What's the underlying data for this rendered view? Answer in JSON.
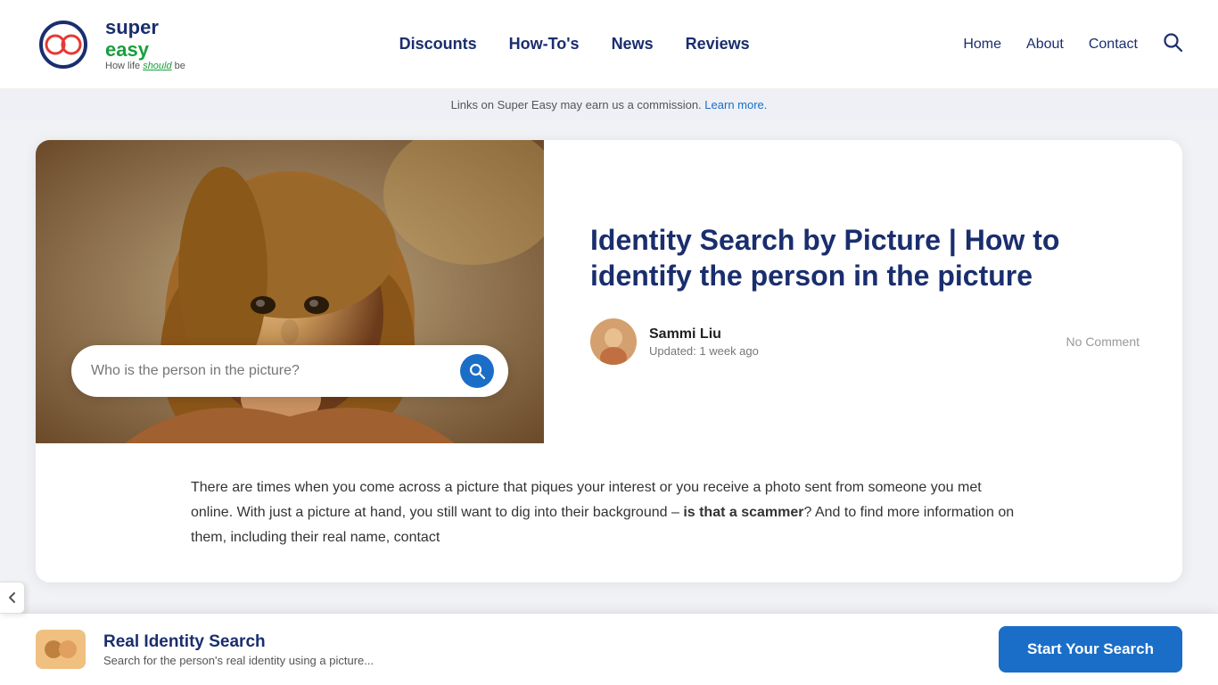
{
  "header": {
    "logo": {
      "brand_super": "super",
      "brand_easy": "easy",
      "tagline": "How life should be"
    },
    "main_nav": [
      {
        "label": "Discounts",
        "href": "#"
      },
      {
        "label": "How-To's",
        "href": "#"
      },
      {
        "label": "News",
        "href": "#"
      },
      {
        "label": "Reviews",
        "href": "#"
      }
    ],
    "right_nav": [
      {
        "label": "Home",
        "href": "#"
      },
      {
        "label": "About",
        "href": "#"
      },
      {
        "label": "Contact",
        "href": "#"
      }
    ]
  },
  "info_bar": {
    "text": "Links on Super Easy may earn us a commission.",
    "link_text": "Learn more."
  },
  "article": {
    "title": "Identity Search by Picture | How to identify the person in the picture",
    "author_name": "Sammi Liu",
    "author_updated": "Updated: 1 week ago",
    "no_comment": "No Comment",
    "search_placeholder": "Who is the person in the picture?",
    "body_text": "There are times when you come across a picture that piques your interest or you receive a photo sent from someone you met online. With just a picture at hand, you still want to dig into their background – ",
    "body_bold": "is that a scammer",
    "body_text2": "? And to find more information on them, including their real name, contact"
  },
  "cta": {
    "title": "Real Identity Search",
    "description": "Search for the person's real identity using a picture...",
    "button_label": "Start Your Search"
  },
  "icons": {
    "search": "🔍",
    "chevron_down": "❯",
    "avatar_emoji": "👩"
  }
}
